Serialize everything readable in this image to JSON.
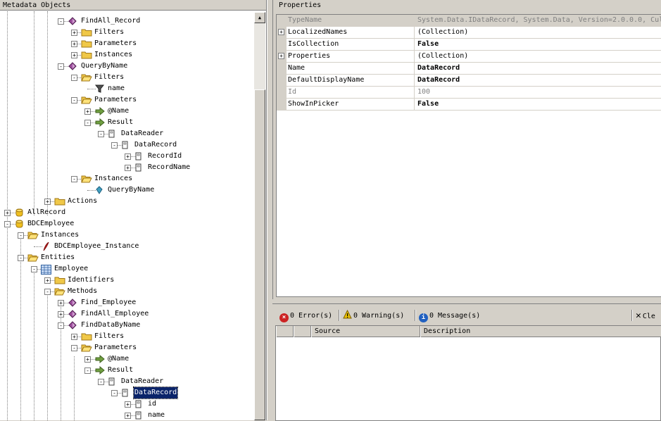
{
  "metadata_panel": {
    "title": "Metadata Objects"
  },
  "tree": [
    {
      "label": "FindAll_Record",
      "icon": "method-icon",
      "depth": 4,
      "expander": "-"
    },
    {
      "label": "Filters",
      "icon": "folder-icon",
      "depth": 5,
      "expander": "+"
    },
    {
      "label": "Parameters",
      "icon": "folder-icon",
      "depth": 5,
      "expander": "+"
    },
    {
      "label": "Instances",
      "icon": "folder-icon",
      "depth": 5,
      "expander": "+"
    },
    {
      "label": "QueryByName",
      "icon": "method-icon",
      "depth": 4,
      "expander": "-"
    },
    {
      "label": "Filters",
      "icon": "folder-open-icon",
      "depth": 5,
      "expander": "-"
    },
    {
      "label": "name",
      "icon": "filter-icon",
      "depth": 6,
      "expander": ""
    },
    {
      "label": "Parameters",
      "icon": "folder-open-icon",
      "depth": 5,
      "expander": "-"
    },
    {
      "label": "@Name",
      "icon": "arrow-in-icon",
      "depth": 6,
      "expander": "+"
    },
    {
      "label": "Result",
      "icon": "arrow-out-icon",
      "depth": 6,
      "expander": "-"
    },
    {
      "label": "DataReader",
      "icon": "type-descriptor-icon",
      "depth": 7,
      "expander": "-"
    },
    {
      "label": "DataRecord",
      "icon": "type-descriptor-icon",
      "depth": 8,
      "expander": "-"
    },
    {
      "label": "RecordId",
      "icon": "type-descriptor-icon",
      "depth": 9,
      "expander": "+"
    },
    {
      "label": "RecordName",
      "icon": "type-descriptor-icon",
      "depth": 9,
      "expander": "+"
    },
    {
      "label": "Instances",
      "icon": "folder-open-icon",
      "depth": 5,
      "expander": "-"
    },
    {
      "label": "QueryByName",
      "icon": "instance-icon",
      "depth": 6,
      "expander": ""
    },
    {
      "label": "Actions",
      "icon": "folder-icon",
      "depth": 3,
      "expander": "+"
    },
    {
      "label": "AllRecord",
      "icon": "database-icon",
      "depth": 0,
      "expander": "+"
    },
    {
      "label": "BDCEmployee",
      "icon": "database-icon",
      "depth": 0,
      "expander": "-"
    },
    {
      "label": "Instances",
      "icon": "folder-open-icon",
      "depth": 1,
      "expander": "-"
    },
    {
      "label": "BDCEmployee_Instance",
      "icon": "lob-instance-icon",
      "depth": 2,
      "expander": ""
    },
    {
      "label": "Entities",
      "icon": "folder-open-icon",
      "depth": 1,
      "expander": "-"
    },
    {
      "label": "Employee",
      "icon": "entity-icon",
      "depth": 2,
      "expander": "-"
    },
    {
      "label": "Identifiers",
      "icon": "folder-icon",
      "depth": 3,
      "expander": "+"
    },
    {
      "label": "Methods",
      "icon": "folder-open-icon",
      "depth": 3,
      "expander": "-"
    },
    {
      "label": "Find_Employee",
      "icon": "method-icon",
      "depth": 4,
      "expander": "+"
    },
    {
      "label": "FindAll_Employee",
      "icon": "method-icon",
      "depth": 4,
      "expander": "+"
    },
    {
      "label": "FindDataByName",
      "icon": "method-icon",
      "depth": 4,
      "expander": "-"
    },
    {
      "label": "Filters",
      "icon": "folder-icon",
      "depth": 5,
      "expander": "+"
    },
    {
      "label": "Parameters",
      "icon": "folder-open-icon",
      "depth": 5,
      "expander": "-"
    },
    {
      "label": "@Name",
      "icon": "arrow-in-icon",
      "depth": 6,
      "expander": "+"
    },
    {
      "label": "Result",
      "icon": "arrow-out-icon",
      "depth": 6,
      "expander": "-"
    },
    {
      "label": "DataReader",
      "icon": "type-descriptor-icon",
      "depth": 7,
      "expander": "-"
    },
    {
      "label": "DataRecord",
      "icon": "type-descriptor-icon",
      "depth": 8,
      "expander": "-",
      "selected": true
    },
    {
      "label": "id",
      "icon": "type-descriptor-icon",
      "depth": 9,
      "expander": "+"
    },
    {
      "label": "name",
      "icon": "type-descriptor-icon",
      "depth": 9,
      "expander": "+"
    }
  ],
  "properties_panel": {
    "title": "Properties",
    "rows": [
      {
        "name": "TypeName",
        "value": "System.Data.IDataRecord, System.Data, Version=2.0.0.0, Cul",
        "readonly": true,
        "bold": false,
        "expander": ""
      },
      {
        "name": "LocalizedNames",
        "value": "(Collection)",
        "readonly": false,
        "bold": false,
        "expander": "+"
      },
      {
        "name": "IsCollection",
        "value": "False",
        "readonly": false,
        "bold": true,
        "expander": ""
      },
      {
        "name": "Properties",
        "value": "(Collection)",
        "readonly": false,
        "bold": false,
        "expander": "+"
      },
      {
        "name": "Name",
        "value": "DataRecord",
        "readonly": false,
        "bold": true,
        "expander": ""
      },
      {
        "name": "DefaultDisplayName",
        "value": "DataRecord",
        "readonly": false,
        "bold": true,
        "expander": ""
      },
      {
        "name": "Id",
        "value": "100",
        "readonly": true,
        "bold": false,
        "expander": ""
      },
      {
        "name": "ShowInPicker",
        "value": "False",
        "readonly": false,
        "bold": true,
        "expander": ""
      }
    ]
  },
  "error_list": {
    "errors_label": "0 Error(s)",
    "warnings_label": "0 Warning(s)",
    "messages_label": "0 Message(s)",
    "clear_label": "Cle",
    "columns": [
      "",
      "",
      "Source",
      "Description"
    ]
  },
  "colors": {
    "selection": "#0a246a",
    "error": "#cc2222",
    "warning": "#e8c000",
    "message": "#2060c0"
  }
}
